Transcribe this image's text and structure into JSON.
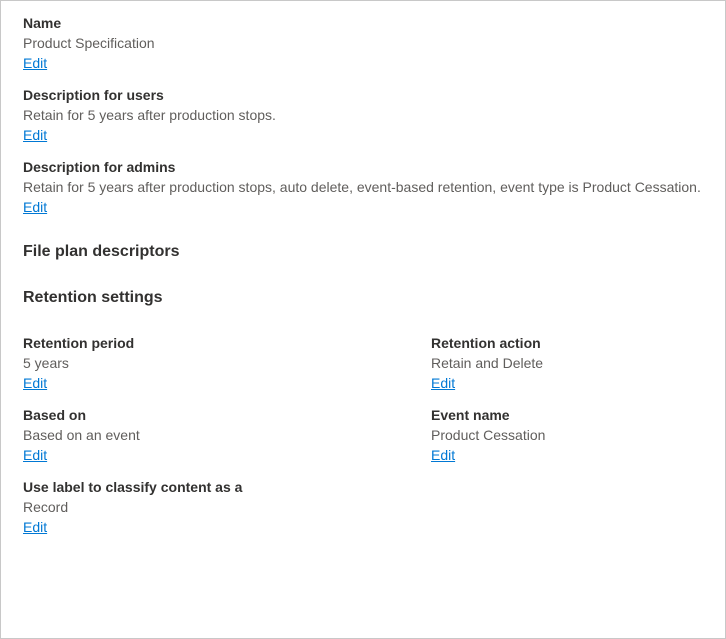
{
  "edit_label": "Edit",
  "name": {
    "label": "Name",
    "value": "Product Specification"
  },
  "desc_users": {
    "label": "Description for users",
    "value": "Retain for 5 years after production stops."
  },
  "desc_admins": {
    "label": "Description for admins",
    "value": "Retain for 5 years after production stops, auto delete, event-based retention, event type is Product Cessation."
  },
  "sections": {
    "file_plan": "File plan descriptors",
    "retention": "Retention settings"
  },
  "retention_period": {
    "label": "Retention period",
    "value": "5 years"
  },
  "retention_action": {
    "label": "Retention action",
    "value": "Retain and Delete"
  },
  "based_on": {
    "label": "Based on",
    "value": "Based on an event"
  },
  "event_name": {
    "label": "Event name",
    "value": "Product Cessation"
  },
  "classify": {
    "label": "Use label to classify content as a",
    "value": "Record"
  }
}
